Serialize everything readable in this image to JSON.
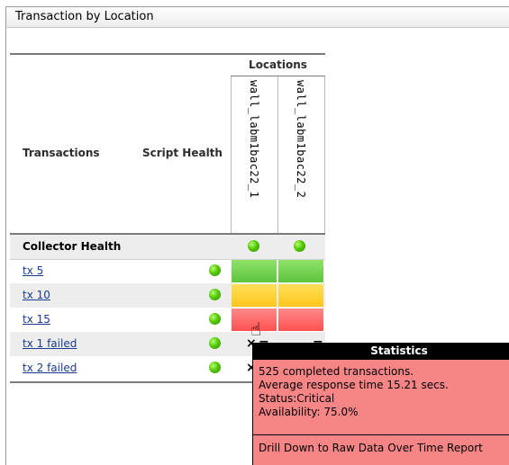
{
  "panel": {
    "title": "Transaction by Location"
  },
  "table": {
    "locations_header": "Locations",
    "col_transactions": "Transactions",
    "col_script_health": "Script Health",
    "locations": [
      "wall_labm1bac22_1",
      "wall_labm1bac22_2"
    ],
    "collector_health_label": "Collector Health",
    "rows": [
      {
        "name": "tx 5",
        "status": [
          "green",
          "green"
        ]
      },
      {
        "name": "tx 10",
        "status": [
          "yellow",
          "yellow"
        ]
      },
      {
        "name": "tx 15",
        "status": [
          "red",
          "red"
        ]
      },
      {
        "name": "tx 1 failed",
        "status": [
          "failed",
          "failed"
        ]
      },
      {
        "name": "tx 2 failed",
        "status": [
          "failed",
          "failed"
        ]
      }
    ],
    "failed_marks": [
      "×",
      "="
    ],
    "status_colors": {
      "green": "#5dc43a",
      "yellow": "#ffc61a",
      "red": "#ff5050",
      "health_dot": "#55c800"
    }
  },
  "tooltip": {
    "title": "Statistics",
    "lines": [
      "525 completed transactions.",
      "Average response time 15.21 secs.",
      "Status:Critical",
      "Availability: 75.0%"
    ],
    "link": "Drill Down to Raw Data Over Time Report"
  }
}
